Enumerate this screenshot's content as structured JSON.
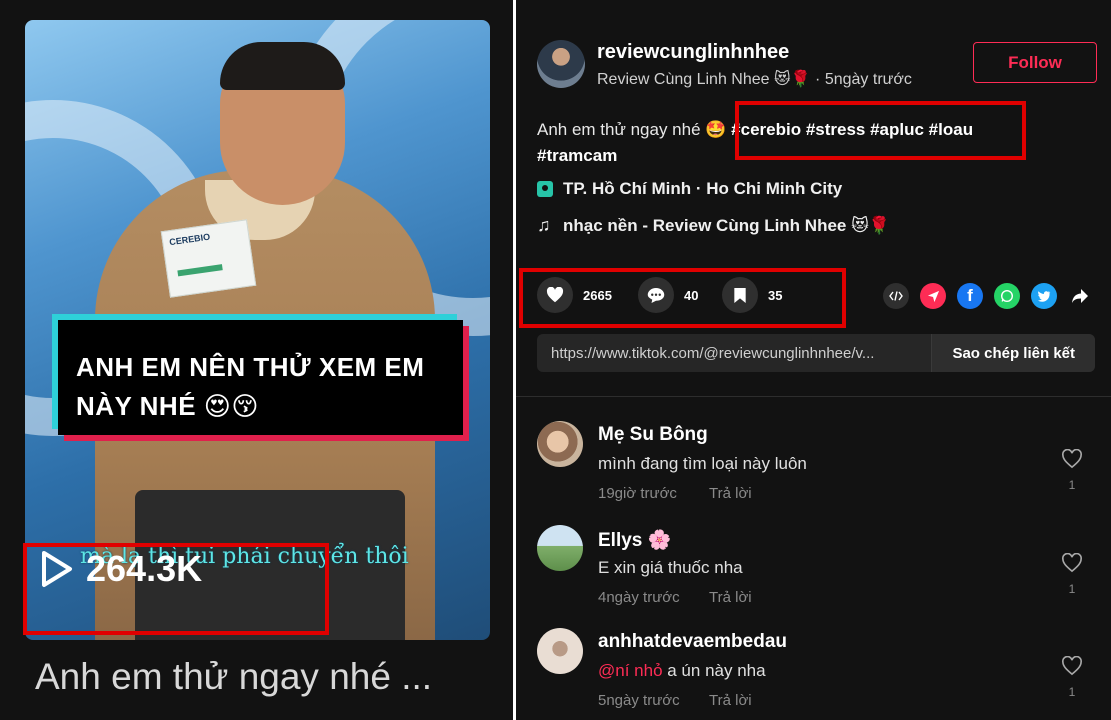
{
  "video": {
    "caption": "ANH EM NÊN THỬ XEM EM NÀY NHÉ 😍😚",
    "subtitle": "mà lạ thì tui phải chuyển thôi",
    "product_logo": "CEREBIO",
    "views": "264.3K",
    "title": "Anh em thử ngay nhé ..."
  },
  "author": {
    "username": "reviewcunglinhnhee",
    "display_name": "Review Cùng Linh Nhee 😻🌹",
    "posted": "5ngày trước"
  },
  "follow_label": "Follow",
  "description": {
    "text": "Anh em thử ngay nhé 🤩",
    "hashtags_line1": "#cerebio #stress #apluc #loau",
    "hashtags_line2": "#tramcam"
  },
  "location": "TP. Hồ Chí Minh · Ho Chi Minh City",
  "music": "nhạc nền - Review Cùng Linh Nhee 😻🌹",
  "stats": {
    "likes": "2665",
    "comments": "40",
    "saves": "35"
  },
  "share": {
    "link": "https://www.tiktok.com/@reviewcunglinhnhee/v...",
    "copy_label": "Sao chép liên kết"
  },
  "colors": {
    "accent": "#fe2c55",
    "background": "#121212",
    "highlight": "#e00000"
  },
  "comments": [
    {
      "name": "Mẹ Su Bông",
      "text": "mình đang tìm loại này luôn",
      "time": "19giờ trước",
      "reply": "Trả lời",
      "likes": "1"
    },
    {
      "name": "Ellys 🌸",
      "text": "E xin giá thuốc nha",
      "time": "4ngày trước",
      "reply": "Trả lời",
      "likes": "1"
    },
    {
      "name": "anhhatdevaembedau",
      "mention": "@ní nhỏ",
      "text": " a ún này nha",
      "time": "5ngày trước",
      "reply": "Trả lời",
      "likes": "1"
    }
  ]
}
